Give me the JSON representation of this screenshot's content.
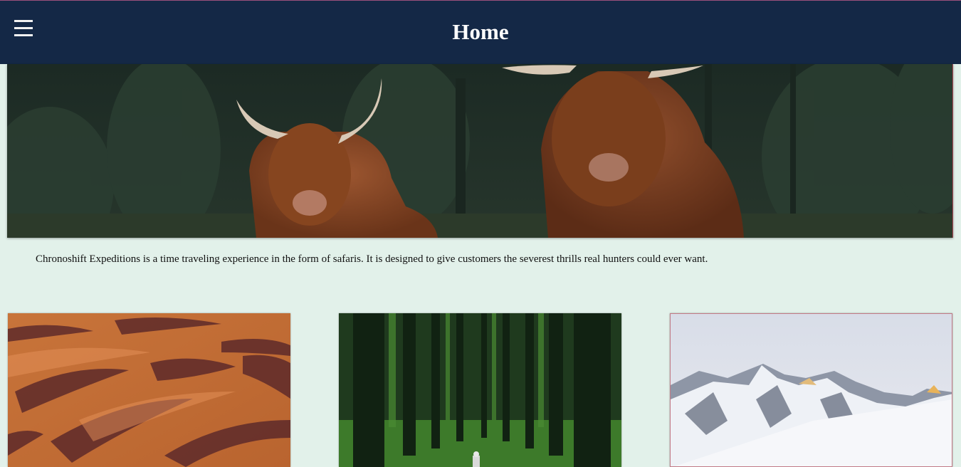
{
  "header": {
    "title": "Home",
    "menu_icon": "hamburger-menu-icon",
    "background_color": "#142846"
  },
  "hero": {
    "image": "highland-cattle-photo"
  },
  "intro": {
    "text": "Chronoshift Expeditions is a time traveling experience in the form of safaris. It is designed to give customers the severest thrills real hunters could ever want."
  },
  "cards": [
    {
      "image": "desert-dunes-photo"
    },
    {
      "image": "forest-path-photo"
    },
    {
      "image": "snowy-mountains-photo"
    }
  ],
  "page": {
    "background_color": "#e2f1ea"
  }
}
